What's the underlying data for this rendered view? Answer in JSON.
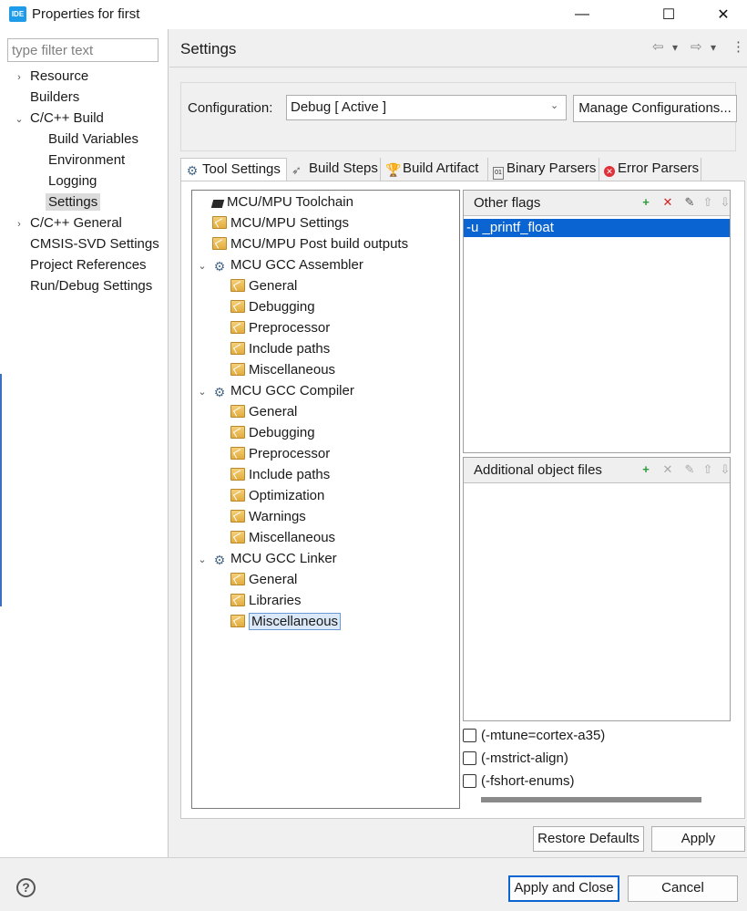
{
  "window": {
    "app_icon_text": "IDE",
    "title": "Properties for first",
    "minimize_glyph": "—",
    "maximize_glyph": "☐",
    "close_glyph": "✕"
  },
  "filter": {
    "placeholder": "type filter text"
  },
  "nav": {
    "items": [
      {
        "label": "Resource",
        "twisty": "›"
      },
      {
        "label": "Builders",
        "twisty": ""
      },
      {
        "label": "C/C++ Build",
        "twisty": "⌄"
      },
      {
        "label": "Build Variables",
        "twisty": ""
      },
      {
        "label": "Environment",
        "twisty": ""
      },
      {
        "label": "Logging",
        "twisty": ""
      },
      {
        "label": "Settings",
        "twisty": ""
      },
      {
        "label": "C/C++ General",
        "twisty": "›"
      },
      {
        "label": "CMSIS-SVD Settings",
        "twisty": ""
      },
      {
        "label": "Project References",
        "twisty": ""
      },
      {
        "label": "Run/Debug Settings",
        "twisty": ""
      }
    ]
  },
  "header": {
    "title": "Settings",
    "back_glyph": "⇦",
    "forward_glyph": "⇨",
    "dropdown_glyph": "▾",
    "menu_glyph": "⋮"
  },
  "config": {
    "label": "Configuration:",
    "value": "Debug  [ Active ]",
    "chevron": "⌄",
    "manage_label": "Manage Configurations..."
  },
  "tabs": [
    {
      "label": "Tool Settings"
    },
    {
      "label": "Build Steps"
    },
    {
      "label": "Build Artifact"
    },
    {
      "label": "Binary Parsers"
    },
    {
      "label": "Error Parsers"
    }
  ],
  "tree": {
    "items": [
      {
        "label": "MCU/MPU Toolchain",
        "twisty": ""
      },
      {
        "label": "MCU/MPU Settings",
        "twisty": ""
      },
      {
        "label": "MCU/MPU Post build outputs",
        "twisty": ""
      },
      {
        "label": "MCU GCC Assembler",
        "twisty": "⌄"
      },
      {
        "label": "General",
        "twisty": ""
      },
      {
        "label": "Debugging",
        "twisty": ""
      },
      {
        "label": "Preprocessor",
        "twisty": ""
      },
      {
        "label": "Include paths",
        "twisty": ""
      },
      {
        "label": "Miscellaneous",
        "twisty": ""
      },
      {
        "label": "MCU GCC Compiler",
        "twisty": "⌄"
      },
      {
        "label": "General",
        "twisty": ""
      },
      {
        "label": "Debugging",
        "twisty": ""
      },
      {
        "label": "Preprocessor",
        "twisty": ""
      },
      {
        "label": "Include paths",
        "twisty": ""
      },
      {
        "label": "Optimization",
        "twisty": ""
      },
      {
        "label": "Warnings",
        "twisty": ""
      },
      {
        "label": "Miscellaneous",
        "twisty": ""
      },
      {
        "label": "MCU GCC Linker",
        "twisty": "⌄"
      },
      {
        "label": "General",
        "twisty": ""
      },
      {
        "label": "Libraries",
        "twisty": ""
      },
      {
        "label": "Miscellaneous",
        "twisty": ""
      }
    ]
  },
  "other_flags": {
    "title": "Other flags",
    "items": [
      "-u _printf_float"
    ]
  },
  "additional_objects": {
    "title": "Additional object files"
  },
  "panel_tools": {
    "add_glyph": "+",
    "delete_glyph": "✕",
    "edit_glyph": "✎",
    "up_glyph": "⇧",
    "down_glyph": "⇩"
  },
  "options": [
    {
      "label": "(-mtune=cortex-a35)",
      "checked": false
    },
    {
      "label": "(-mstrict-align)",
      "checked": false
    },
    {
      "label": "(-fshort-enums)",
      "checked": false
    }
  ],
  "buttons": {
    "restore_defaults": "Restore Defaults",
    "apply": "Apply",
    "apply_and_close": "Apply and Close",
    "cancel": "Cancel",
    "help_glyph": "?"
  },
  "colors": {
    "selection": "#0a64d2",
    "accent_icon": "#1e9be9"
  }
}
